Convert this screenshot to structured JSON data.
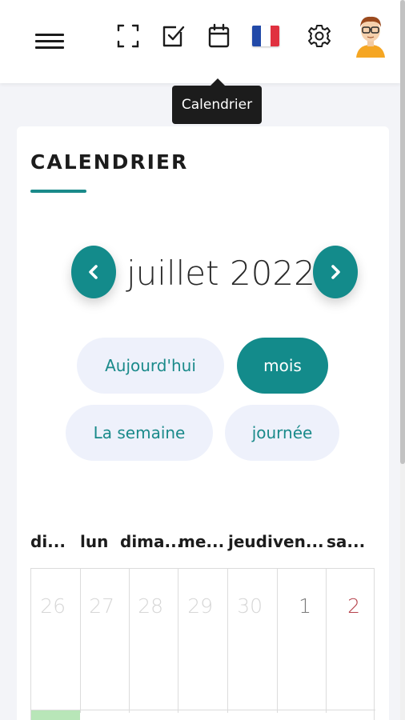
{
  "header": {
    "icons": [
      "menu-icon",
      "fullscreen-icon",
      "task-check-icon",
      "calendar-icon",
      "flag-fr-icon",
      "settings-icon",
      "user-avatar"
    ],
    "flag_colors": [
      "#2149a8",
      "#ffffff",
      "#e0313f"
    ]
  },
  "tooltip": {
    "text": "Calendrier"
  },
  "page": {
    "title": "CALENDRIER"
  },
  "calendar": {
    "month_label": "juillet 2022",
    "view_buttons": [
      {
        "label": "Aujourd'hui",
        "active": false
      },
      {
        "label": "mois",
        "active": true
      },
      {
        "label": "La semaine",
        "active": false
      },
      {
        "label": "journée",
        "active": false
      }
    ],
    "weekdays": [
      "di...",
      "lun",
      "dima...",
      "me...",
      "jeudi",
      "ven...",
      "sa..."
    ],
    "days": [
      {
        "num": "26",
        "state": "outside"
      },
      {
        "num": "27",
        "state": "outside"
      },
      {
        "num": "28",
        "state": "outside"
      },
      {
        "num": "29",
        "state": "outside"
      },
      {
        "num": "30",
        "state": "outside"
      },
      {
        "num": "1",
        "state": "current"
      },
      {
        "num": "2",
        "state": "weekend"
      }
    ],
    "colors": {
      "accent": "#138b8b",
      "weekend": "#b5414a",
      "outside": "#d6d6d6",
      "current": "#7a7a7a",
      "today": "#b8e6b8"
    }
  }
}
